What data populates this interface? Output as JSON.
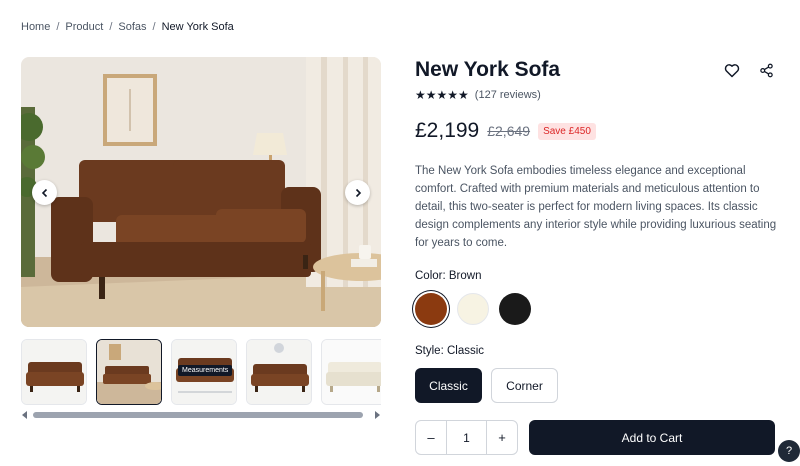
{
  "breadcrumb": {
    "items": [
      "Home",
      "Product",
      "Sofas"
    ],
    "separator": "/",
    "current": "New York Sofa"
  },
  "gallery": {
    "thumbnail_badge": "Measurements"
  },
  "product": {
    "title": "New York Sofa",
    "stars": "★★★★★",
    "reviews": "(127 reviews)",
    "price": "£2,199",
    "old_price": "£2,649",
    "save": "Save £450",
    "description": "The New York Sofa embodies timeless elegance and exceptional comfort. Crafted with premium materials and meticulous attention to detail, this two-seater is perfect for modern living spaces. Its classic design complements any interior style while providing luxurious seating for years to come."
  },
  "color": {
    "label": "Color: Brown",
    "swatches": [
      {
        "name": "Brown",
        "hex": "#8b3a10"
      },
      {
        "name": "Cream",
        "hex": "#f7f3e3"
      },
      {
        "name": "Black",
        "hex": "#1a1a1a"
      }
    ]
  },
  "style": {
    "label": "Style: Classic",
    "options": [
      "Classic",
      "Corner"
    ]
  },
  "quantity": {
    "minus": "–",
    "value": "1",
    "plus": "+"
  },
  "cart": {
    "add_label": "Add to Cart"
  },
  "help": {
    "label": "?"
  },
  "colors": {
    "primary": "#111827",
    "sale_text": "#dc2626",
    "sale_bg": "#fee2e2",
    "sofa_brown": "#6b3a1f"
  }
}
